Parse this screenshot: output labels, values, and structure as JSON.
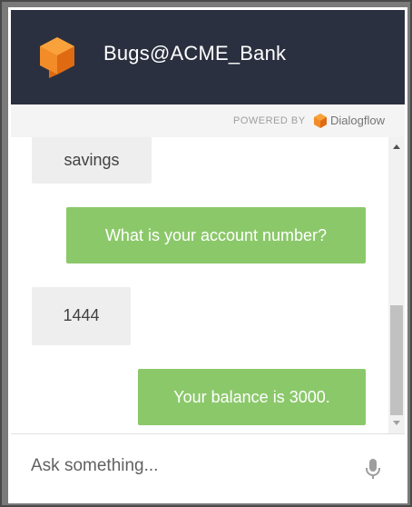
{
  "header": {
    "title": "Bugs@ACME_Bank",
    "logo_icon": "chat-bubble-cube-icon",
    "background_color": "#2b3040"
  },
  "powered": {
    "label": "POWERED BY",
    "brand_name": "Dialogflow",
    "brand_icon": "dialogflow-logo-icon"
  },
  "messages": [
    {
      "sender": "user",
      "text": "savings"
    },
    {
      "sender": "bot",
      "text": "What is your account number?"
    },
    {
      "sender": "user",
      "text": "1444"
    },
    {
      "sender": "bot",
      "text": "Your balance is 3000."
    }
  ],
  "input": {
    "placeholder": "Ask something...",
    "value": ""
  },
  "mic": {
    "icon": "microphone-icon"
  },
  "colors": {
    "bot_bubble": "#8bc86a",
    "user_bubble": "#eeeeee",
    "accent_orange": "#f07c1b"
  }
}
